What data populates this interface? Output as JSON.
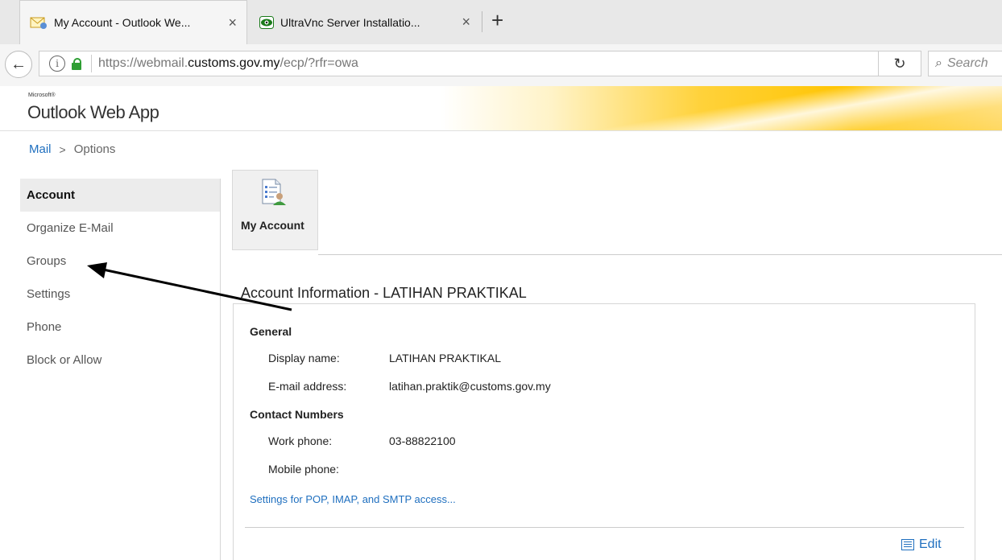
{
  "browser": {
    "tabs": [
      {
        "title": "My Account - Outlook We...",
        "active": true,
        "icon": "outlook-mail-icon"
      },
      {
        "title": "UltraVnc Server Installatio...",
        "active": false,
        "icon": "ultravnc-eye-icon"
      }
    ],
    "new_tab_label": "+",
    "close_glyph": "×",
    "url": {
      "prefix": "https://webmail.",
      "domain": "customs.gov.my",
      "suffix": "/ecp/?rfr=owa"
    },
    "search_placeholder": "Search"
  },
  "header": {
    "microsoft_label": "Microsoft®",
    "app_name": "Outlook Web App"
  },
  "breadcrumb": {
    "mail": "Mail",
    "separator": ">",
    "current": "Options"
  },
  "sidebar": {
    "items": [
      {
        "label": "Account",
        "selected": true
      },
      {
        "label": "Organize E-Mail",
        "selected": false
      },
      {
        "label": "Groups",
        "selected": false
      },
      {
        "label": "Settings",
        "selected": false
      },
      {
        "label": "Phone",
        "selected": false
      },
      {
        "label": "Block or Allow",
        "selected": false
      }
    ]
  },
  "main": {
    "tile_label": "My Account",
    "section_title": "Account Information - LATIHAN PRAKTIKAL",
    "general": {
      "heading": "General",
      "display_name_label": "Display name:",
      "display_name": "LATIHAN PRAKTIKAL",
      "email_label": "E-mail address:",
      "email": "latihan.praktik@customs.gov.my"
    },
    "contact": {
      "heading": "Contact Numbers",
      "work_label": "Work phone:",
      "work": "03-88822100",
      "mobile_label": "Mobile phone:",
      "mobile": ""
    },
    "pop_link": "Settings for POP, IMAP, and SMTP access...",
    "edit_label": "Edit"
  },
  "colors": {
    "link": "#1f6fbf",
    "brand_yellow": "#ffc400",
    "lock_green": "#2e9e33"
  }
}
